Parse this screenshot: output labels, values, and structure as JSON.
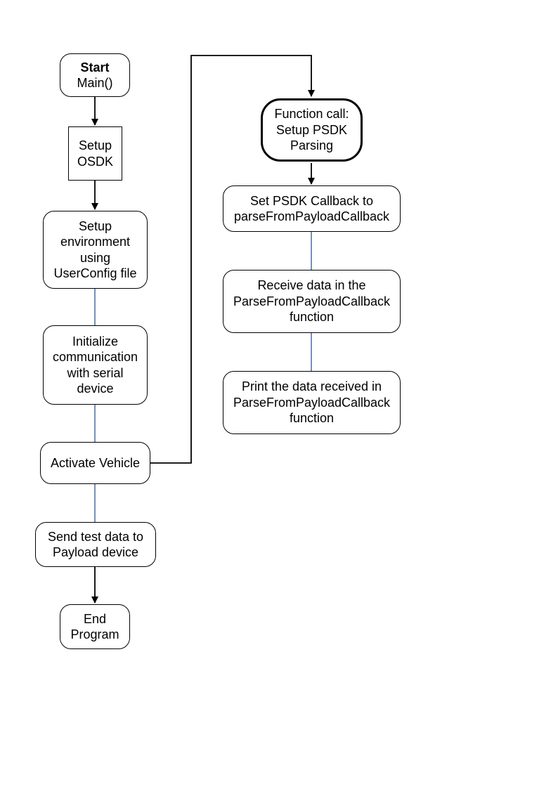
{
  "flow": {
    "start_title": "Start",
    "start_sub": "Main()",
    "setup_osdk_l1": "Setup",
    "setup_osdk_l2": "OSDK",
    "env_l1": "Setup",
    "env_l2": "environment",
    "env_l3": "using",
    "env_l4": "UserConfig file",
    "init_l1": "Initialize",
    "init_l2": "communication",
    "init_l3": "with serial",
    "init_l4": "device",
    "activate": "Activate Vehicle",
    "send_l1": "Send test data to",
    "send_l2": "Payload device",
    "end_l1": "End",
    "end_l2": "Program",
    "func_l1": "Function call:",
    "func_l2": "Setup PSDK",
    "func_l3": "Parsing",
    "cb_l1": "Set PSDK Callback to",
    "cb_l2": "parseFromPayloadCallback",
    "recv_l1": "Receive data in the",
    "recv_l2": "ParseFromPayloadCallback",
    "recv_l3": "function",
    "print_l1": "Print the data received in",
    "print_l2": "ParseFromPayloadCallback",
    "print_l3": "function"
  }
}
